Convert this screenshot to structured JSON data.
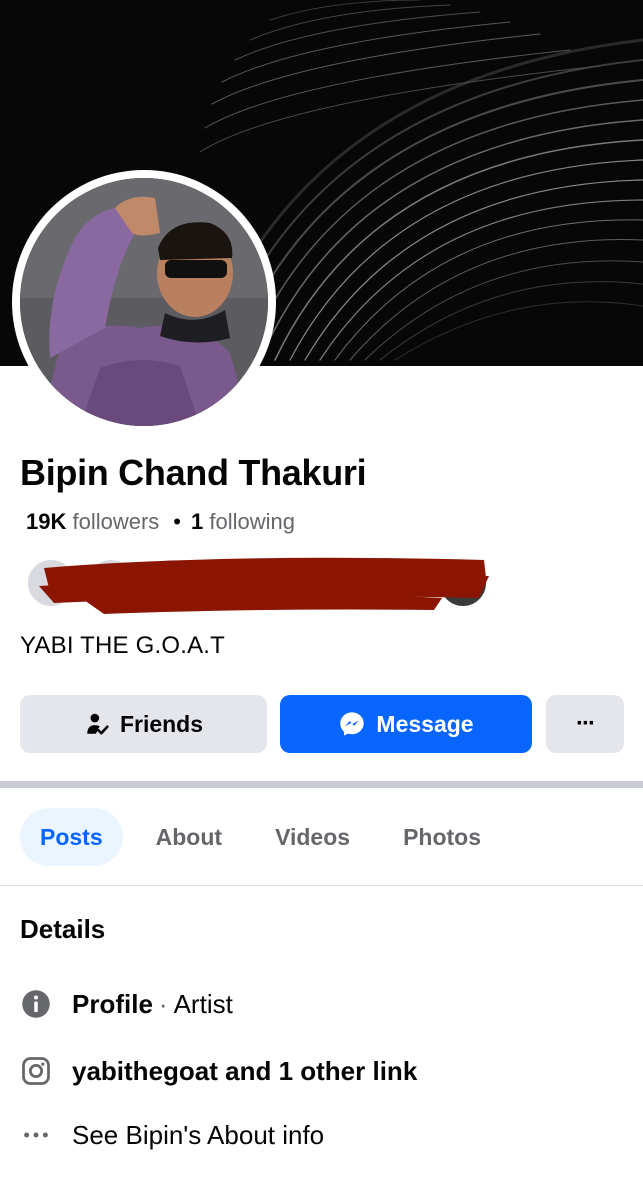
{
  "profile": {
    "name": "Bipin Chand Thakuri",
    "followers_count": "19K",
    "followers_label": "followers",
    "following_count": "1",
    "following_label": "following",
    "bio": "YABI THE G.O.A.T"
  },
  "actions": {
    "friends_label": "Friends",
    "message_label": "Message",
    "more_label": "···"
  },
  "tabs": [
    {
      "label": "Posts",
      "active": true
    },
    {
      "label": "About",
      "active": false
    },
    {
      "label": "Videos",
      "active": false
    },
    {
      "label": "Photos",
      "active": false
    }
  ],
  "details": {
    "title": "Details",
    "profile_label": "Profile",
    "profile_separator": "·",
    "profile_category": "Artist",
    "links_text": "yabithegoat and 1 other link",
    "about_text": "See Bipin's About info"
  },
  "icons": {
    "friends": "person-check-icon",
    "message": "messenger-icon",
    "more": "more-horizontal-icon",
    "info": "info-icon",
    "instagram": "instagram-icon",
    "see_more": "ellipsis-icon"
  },
  "colors": {
    "accent": "#0866ff",
    "button_gray": "#e4e6eb",
    "text_secondary": "#65676b",
    "redaction": "#8b1500"
  }
}
